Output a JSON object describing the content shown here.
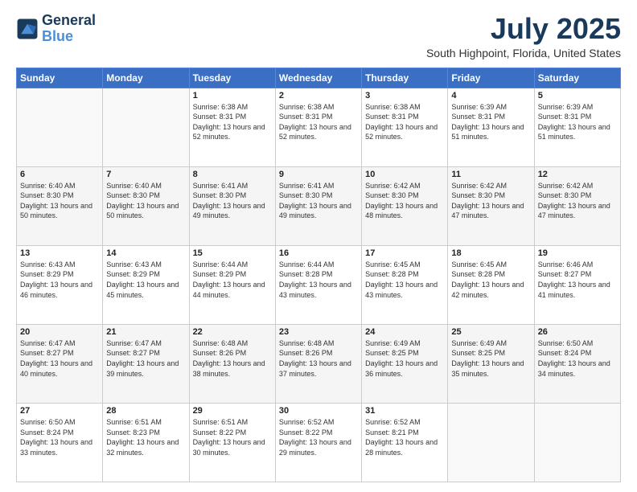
{
  "header": {
    "logo_line1": "General",
    "logo_line2": "Blue",
    "month": "July 2025",
    "location": "South Highpoint, Florida, United States"
  },
  "days_of_week": [
    "Sunday",
    "Monday",
    "Tuesday",
    "Wednesday",
    "Thursday",
    "Friday",
    "Saturday"
  ],
  "weeks": [
    [
      {
        "day": "",
        "info": ""
      },
      {
        "day": "",
        "info": ""
      },
      {
        "day": "1",
        "info": "Sunrise: 6:38 AM\nSunset: 8:31 PM\nDaylight: 13 hours and 52 minutes."
      },
      {
        "day": "2",
        "info": "Sunrise: 6:38 AM\nSunset: 8:31 PM\nDaylight: 13 hours and 52 minutes."
      },
      {
        "day": "3",
        "info": "Sunrise: 6:38 AM\nSunset: 8:31 PM\nDaylight: 13 hours and 52 minutes."
      },
      {
        "day": "4",
        "info": "Sunrise: 6:39 AM\nSunset: 8:31 PM\nDaylight: 13 hours and 51 minutes."
      },
      {
        "day": "5",
        "info": "Sunrise: 6:39 AM\nSunset: 8:31 PM\nDaylight: 13 hours and 51 minutes."
      }
    ],
    [
      {
        "day": "6",
        "info": "Sunrise: 6:40 AM\nSunset: 8:30 PM\nDaylight: 13 hours and 50 minutes."
      },
      {
        "day": "7",
        "info": "Sunrise: 6:40 AM\nSunset: 8:30 PM\nDaylight: 13 hours and 50 minutes."
      },
      {
        "day": "8",
        "info": "Sunrise: 6:41 AM\nSunset: 8:30 PM\nDaylight: 13 hours and 49 minutes."
      },
      {
        "day": "9",
        "info": "Sunrise: 6:41 AM\nSunset: 8:30 PM\nDaylight: 13 hours and 49 minutes."
      },
      {
        "day": "10",
        "info": "Sunrise: 6:42 AM\nSunset: 8:30 PM\nDaylight: 13 hours and 48 minutes."
      },
      {
        "day": "11",
        "info": "Sunrise: 6:42 AM\nSunset: 8:30 PM\nDaylight: 13 hours and 47 minutes."
      },
      {
        "day": "12",
        "info": "Sunrise: 6:42 AM\nSunset: 8:30 PM\nDaylight: 13 hours and 47 minutes."
      }
    ],
    [
      {
        "day": "13",
        "info": "Sunrise: 6:43 AM\nSunset: 8:29 PM\nDaylight: 13 hours and 46 minutes."
      },
      {
        "day": "14",
        "info": "Sunrise: 6:43 AM\nSunset: 8:29 PM\nDaylight: 13 hours and 45 minutes."
      },
      {
        "day": "15",
        "info": "Sunrise: 6:44 AM\nSunset: 8:29 PM\nDaylight: 13 hours and 44 minutes."
      },
      {
        "day": "16",
        "info": "Sunrise: 6:44 AM\nSunset: 8:28 PM\nDaylight: 13 hours and 43 minutes."
      },
      {
        "day": "17",
        "info": "Sunrise: 6:45 AM\nSunset: 8:28 PM\nDaylight: 13 hours and 43 minutes."
      },
      {
        "day": "18",
        "info": "Sunrise: 6:45 AM\nSunset: 8:28 PM\nDaylight: 13 hours and 42 minutes."
      },
      {
        "day": "19",
        "info": "Sunrise: 6:46 AM\nSunset: 8:27 PM\nDaylight: 13 hours and 41 minutes."
      }
    ],
    [
      {
        "day": "20",
        "info": "Sunrise: 6:47 AM\nSunset: 8:27 PM\nDaylight: 13 hours and 40 minutes."
      },
      {
        "day": "21",
        "info": "Sunrise: 6:47 AM\nSunset: 8:27 PM\nDaylight: 13 hours and 39 minutes."
      },
      {
        "day": "22",
        "info": "Sunrise: 6:48 AM\nSunset: 8:26 PM\nDaylight: 13 hours and 38 minutes."
      },
      {
        "day": "23",
        "info": "Sunrise: 6:48 AM\nSunset: 8:26 PM\nDaylight: 13 hours and 37 minutes."
      },
      {
        "day": "24",
        "info": "Sunrise: 6:49 AM\nSunset: 8:25 PM\nDaylight: 13 hours and 36 minutes."
      },
      {
        "day": "25",
        "info": "Sunrise: 6:49 AM\nSunset: 8:25 PM\nDaylight: 13 hours and 35 minutes."
      },
      {
        "day": "26",
        "info": "Sunrise: 6:50 AM\nSunset: 8:24 PM\nDaylight: 13 hours and 34 minutes."
      }
    ],
    [
      {
        "day": "27",
        "info": "Sunrise: 6:50 AM\nSunset: 8:24 PM\nDaylight: 13 hours and 33 minutes."
      },
      {
        "day": "28",
        "info": "Sunrise: 6:51 AM\nSunset: 8:23 PM\nDaylight: 13 hours and 32 minutes."
      },
      {
        "day": "29",
        "info": "Sunrise: 6:51 AM\nSunset: 8:22 PM\nDaylight: 13 hours and 30 minutes."
      },
      {
        "day": "30",
        "info": "Sunrise: 6:52 AM\nSunset: 8:22 PM\nDaylight: 13 hours and 29 minutes."
      },
      {
        "day": "31",
        "info": "Sunrise: 6:52 AM\nSunset: 8:21 PM\nDaylight: 13 hours and 28 minutes."
      },
      {
        "day": "",
        "info": ""
      },
      {
        "day": "",
        "info": ""
      }
    ]
  ]
}
